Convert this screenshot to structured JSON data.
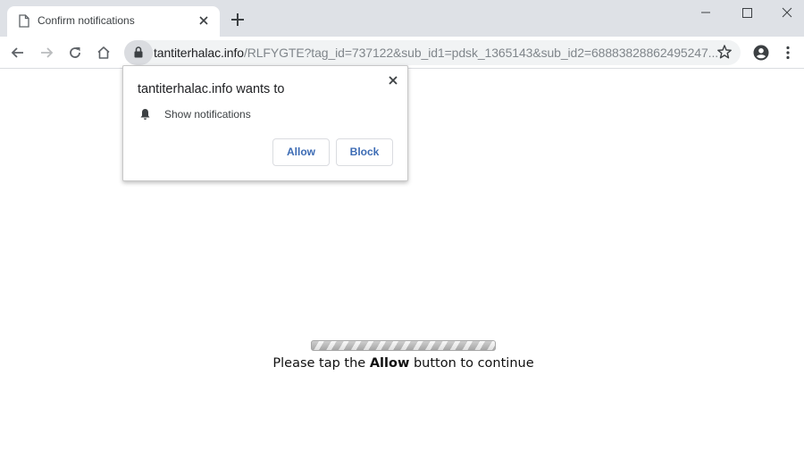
{
  "browser": {
    "tab": {
      "title": "Confirm notifications",
      "icon": "page-icon",
      "close_icon": "close-icon"
    },
    "new_tab_icon": "plus-icon",
    "window_controls": [
      "minimize-icon",
      "maximize-icon",
      "close-icon"
    ],
    "toolbar": {
      "back_icon": "arrow-left-icon",
      "forward_icon": "arrow-right-icon",
      "reload_icon": "reload-icon",
      "home_icon": "home-icon",
      "security_icon": "lock-icon",
      "url_host": "tantiterhalac.info",
      "url_path": "/RLFYGTE?tag_id=737122&sub_id1=pdsk_1365143&sub_id2=68883828862495247...",
      "bookmark_icon": "star-icon",
      "profile_icon": "account-icon",
      "menu_icon": "more-vert-icon"
    }
  },
  "permission_popup": {
    "title": "tantiterhalac.info wants to",
    "permission_icon": "bell-icon",
    "permission_label": "Show notifications",
    "allow_label": "Allow",
    "block_label": "Block",
    "close_icon": "close-icon"
  },
  "page": {
    "message_prefix": "Please tap the ",
    "message_bold": "Allow",
    "message_suffix": " button to continue"
  }
}
